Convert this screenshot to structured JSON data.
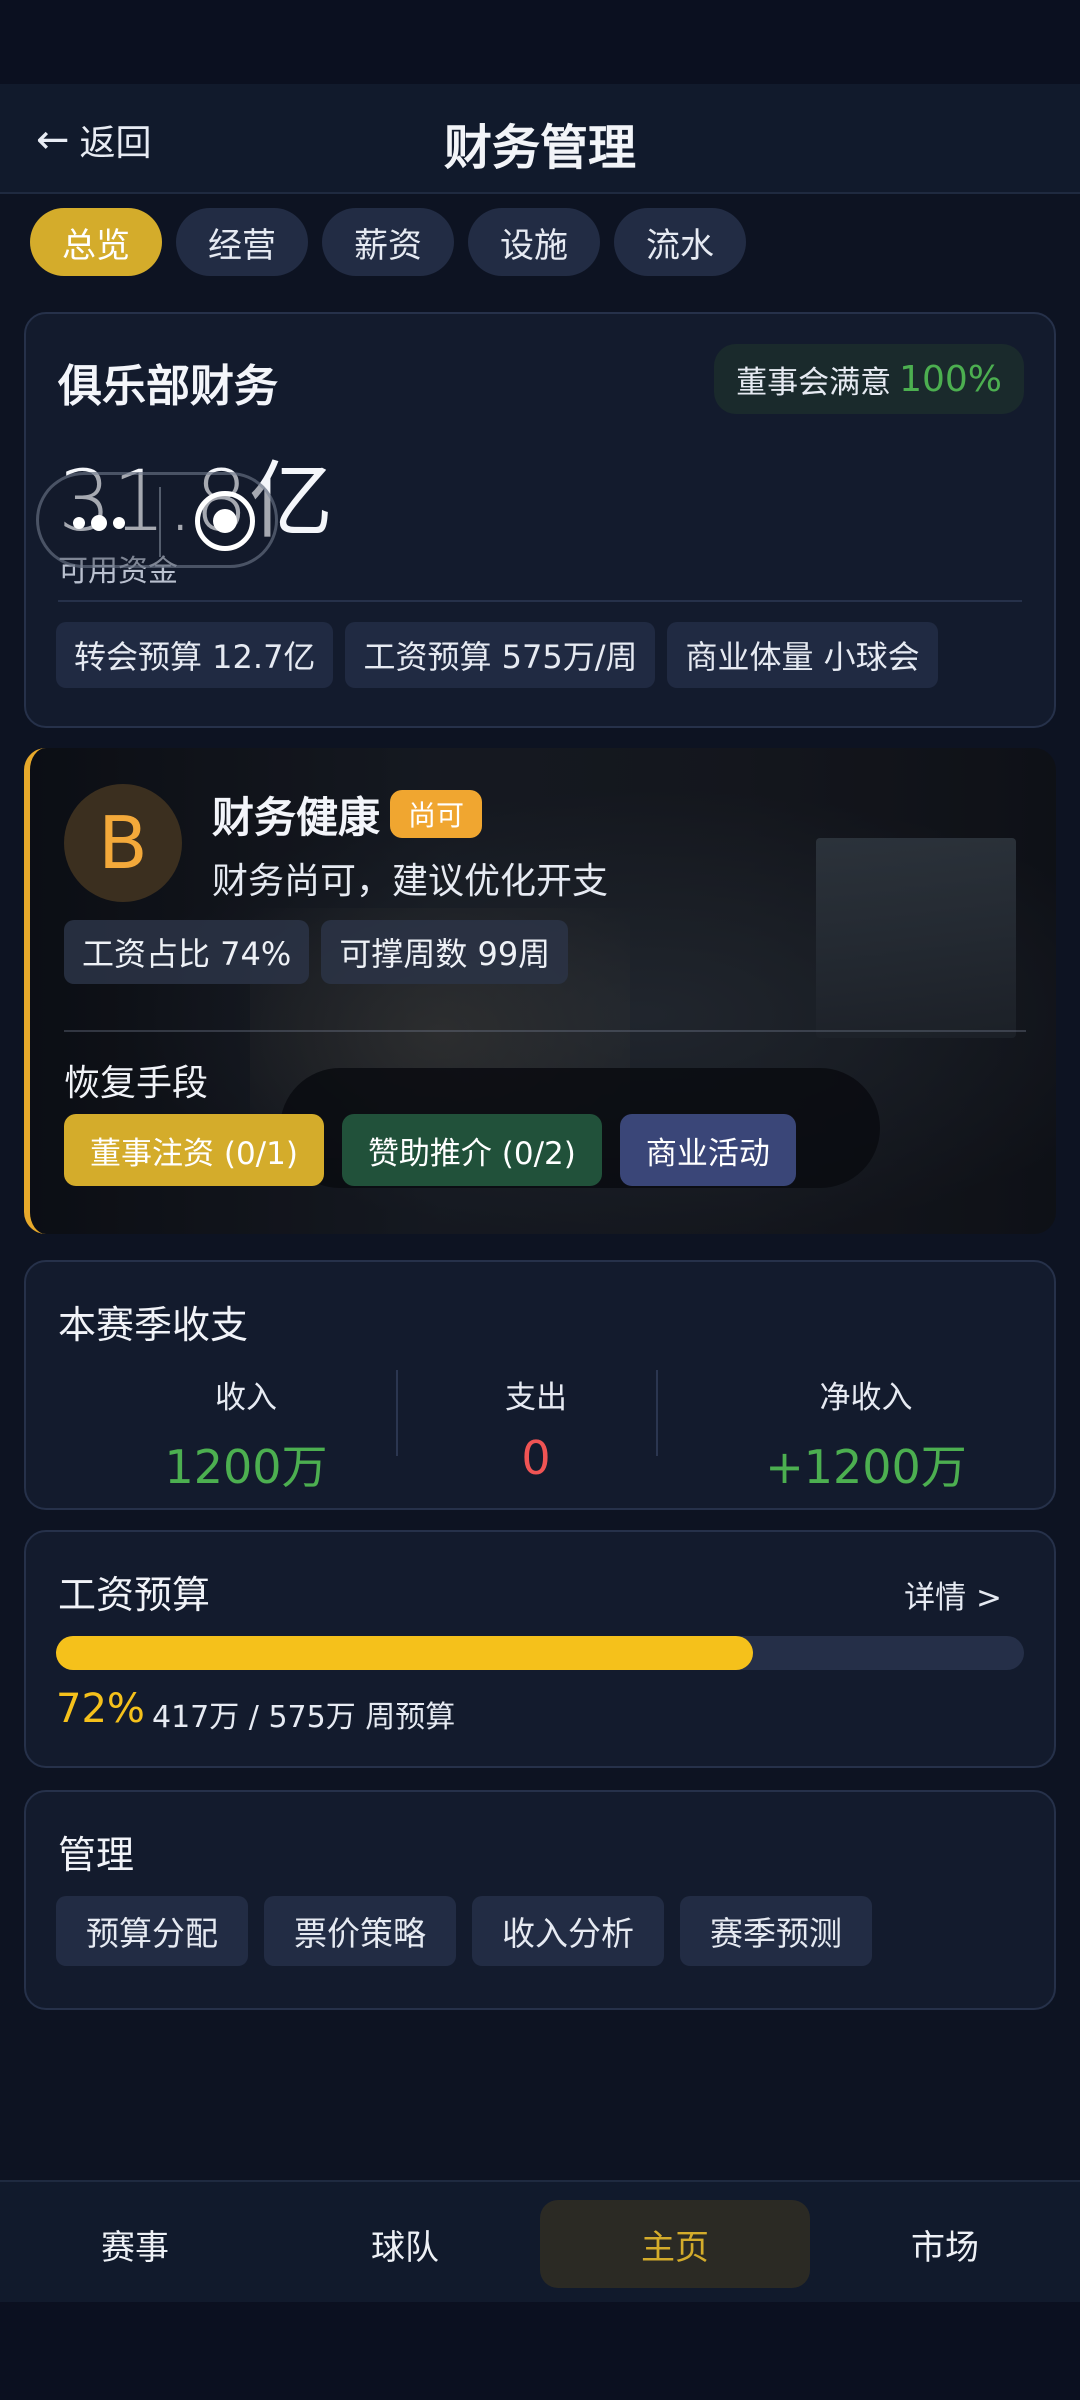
{
  "header": {
    "back_label": "返回",
    "title": "财务管理"
  },
  "tabs": [
    {
      "label": "总览",
      "active": true
    },
    {
      "label": "经营",
      "active": false
    },
    {
      "label": "薪资",
      "active": false
    },
    {
      "label": "设施",
      "active": false
    },
    {
      "label": "流水",
      "active": false
    }
  ],
  "finance": {
    "title": "俱乐部财务",
    "board_label": "董事会满意",
    "board_value": "100%",
    "amount": "31.8亿",
    "amount_label": "可用资金",
    "chips": [
      "转会预算 12.7亿",
      "工资预算 575万/周",
      "商业体量 小球会"
    ]
  },
  "health": {
    "grade": "B",
    "title": "财务健康",
    "tag": "尚可",
    "desc": "财务尚可，建议优化开支",
    "chips": [
      "工资占比 74%",
      "可撑周数 99周"
    ],
    "recover_title": "恢复手段",
    "recover_buttons": [
      "董事注资 (0/1)",
      "赞助推介 (0/2)",
      "商业活动"
    ]
  },
  "season": {
    "title": "本赛季收支",
    "income_label": "收入",
    "income_value": "1200万",
    "expense_label": "支出",
    "expense_value": "0",
    "net_label": "净收入",
    "net_value": "+1200万"
  },
  "wage": {
    "title": "工资预算",
    "detail": "详情 >",
    "percent": "72%",
    "progress": 0.72,
    "text": "417万 / 575万 周预算"
  },
  "manage": {
    "title": "管理",
    "buttons": [
      "预算分配",
      "票价策略",
      "收入分析",
      "赛季预测"
    ]
  },
  "nav": [
    {
      "label": "赛事",
      "active": false
    },
    {
      "label": "球队",
      "active": false
    },
    {
      "label": "主页",
      "active": true
    },
    {
      "label": "市场",
      "active": false
    }
  ],
  "colors": {
    "accent": "#d4ac2b",
    "positive": "#4caf50",
    "negative": "#f05454",
    "progress": "#f5c11b"
  }
}
